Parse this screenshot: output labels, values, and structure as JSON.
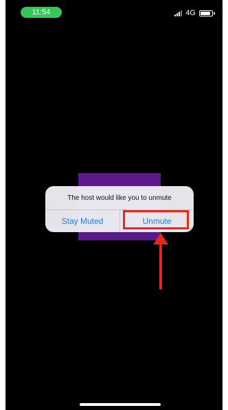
{
  "status_bar": {
    "time": "11:54",
    "network": "4G"
  },
  "alert": {
    "message": "The host would like you to unmute",
    "stay_muted_label": "Stay Muted",
    "unmute_label": "Unmute"
  },
  "colors": {
    "background": "#000000",
    "time_pill": "#34c759",
    "video_tile": "#5a1a8a",
    "button_text": "#1e7cf2",
    "annotation": "#e8261a"
  },
  "icons": [
    "signal-icon",
    "battery-icon"
  ]
}
